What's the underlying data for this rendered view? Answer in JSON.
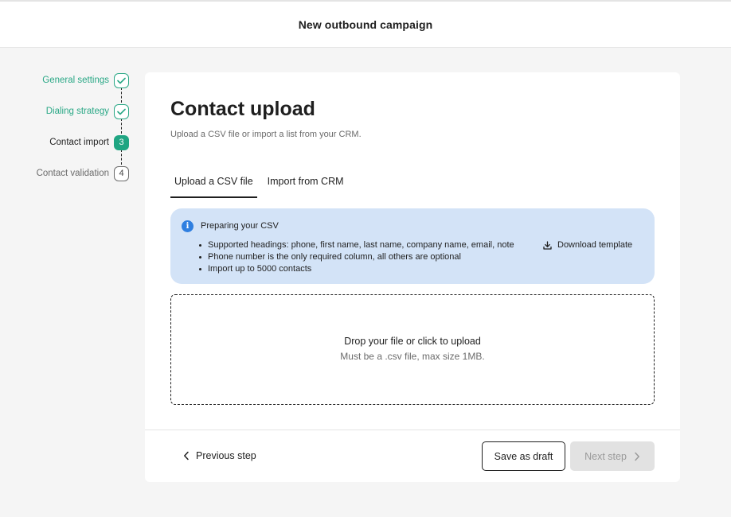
{
  "header": {
    "title": "New outbound campaign"
  },
  "stepper": {
    "steps": [
      {
        "label": "General settings",
        "status": "done",
        "badge": ""
      },
      {
        "label": "Dialing strategy",
        "status": "done",
        "badge": ""
      },
      {
        "label": "Contact import",
        "status": "active",
        "badge": "3"
      },
      {
        "label": "Contact validation",
        "status": "todo",
        "badge": "4"
      }
    ]
  },
  "main": {
    "title": "Contact upload",
    "subtitle": "Upload a CSV file or import a list from your CRM.",
    "tabs": [
      {
        "label": "Upload a CSV file",
        "active": true
      },
      {
        "label": "Import from CRM",
        "active": false
      }
    ],
    "info": {
      "icon": "info-icon",
      "title": "Preparing your CSV",
      "items": [
        "Supported headings: phone, first name, last name, company name, email, note",
        "Phone number is the only required column, all others are optional",
        "Import up to 5000 contacts"
      ],
      "download_label": "Download template"
    },
    "dropzone": {
      "title": "Drop your file or click to upload",
      "subtitle": "Must be a .csv file, max size 1MB."
    }
  },
  "footer": {
    "previous_label": "Previous step",
    "draft_label": "Save as draft",
    "next_label": "Next step"
  },
  "colors": {
    "accent": "#1fa582",
    "info_background": "#d3e3f7",
    "info_icon": "#2f7fe0",
    "disabled_button": "#e2e2e2"
  }
}
